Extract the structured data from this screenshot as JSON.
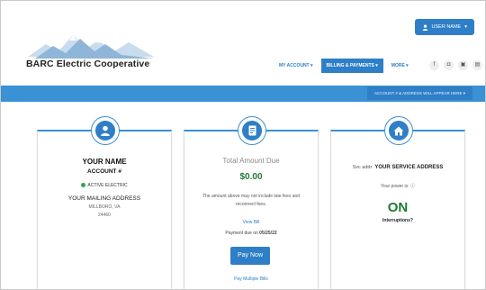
{
  "header": {
    "brand": "BARC Electric Cooperative",
    "user_button": "USER NAME",
    "nav": {
      "my_account": "MY ACCOUNT",
      "billing": "BILLING & PAYMENTS",
      "more": "MORE"
    },
    "social_icons": [
      "facebook-icon",
      "instagram-icon",
      "youtube-icon",
      "app-icon"
    ]
  },
  "account_bar": {
    "selector_label": "ACCOUNT # & ADDRESS WILL APPEAR HERE"
  },
  "card_account": {
    "icon": "user-icon",
    "name": "YOUR NAME",
    "account": "ACCOUNT #",
    "status": "ACTIVE ELECTRIC",
    "status_color": "#2fa84f",
    "mailing_address": "YOUR MAILING ADDRESS",
    "city": "MILLBORO, VA",
    "zip": "24460"
  },
  "card_amount": {
    "icon": "bill-icon",
    "title": "Total Amount Due",
    "amount": "$0.00",
    "note": "The amount above may not include late fees and reconnect fees.",
    "view_bill": "View Bill",
    "due_prefix": "Payment due on",
    "due_date": "05/25/22",
    "pay_now": "Pay Now",
    "pay_multiple": "Pay Multiple Bills"
  },
  "card_service": {
    "icon": "home-icon",
    "service_label": "Svc addr:",
    "service_address": "YOUR SERVICE ADDRESS",
    "power_label": "Your power is:",
    "power_state": "ON",
    "interruptions": "Interruptions?"
  },
  "colors": {
    "accent": "#2e7fc7",
    "bar": "#3a91d4",
    "power_on": "#1f7a33"
  }
}
